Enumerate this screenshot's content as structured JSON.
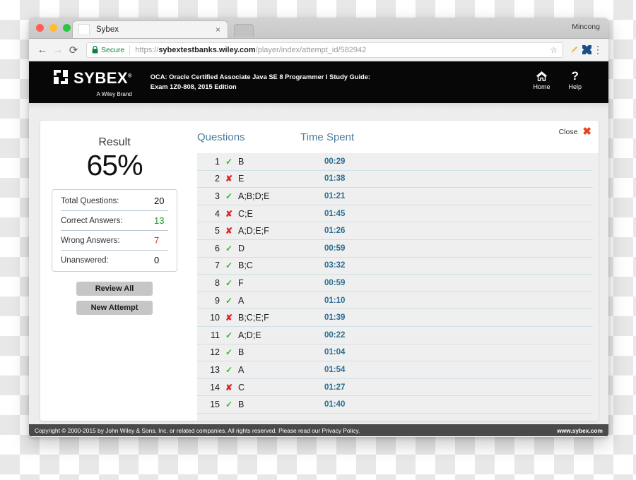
{
  "browser": {
    "tab_title": "Sybex",
    "tab_close": "×",
    "profile_name": "Mincong",
    "back_icon": "←",
    "forward_icon": "→",
    "reload_icon": "⟳",
    "secure_label": "Secure",
    "url_scheme": "https://",
    "url_domain": "sybextestbanks.wiley.com",
    "url_path": "/player/index/attempt_id/582942",
    "star_icon": "☆",
    "menu_icon": "⋮"
  },
  "site_header": {
    "logo_word": "SYBEX",
    "logo_reg": "®",
    "logo_sub": "A Wiley Brand",
    "book_title_line1": "OCA: Oracle Certified Associate Java SE 8 Programmer I Study Guide:",
    "book_title_line2": "Exam 1Z0-808, 2015 Edition",
    "actions": [
      {
        "label": "Home",
        "icon": "home-icon"
      },
      {
        "label": "Help",
        "icon": "question-mark-icon",
        "glyph": "?"
      }
    ]
  },
  "result_panel": {
    "title": "Result",
    "percent": "65%",
    "stats": [
      {
        "label": "Total Questions:",
        "value": "20",
        "color": "default"
      },
      {
        "label": "Correct Answers:",
        "value": "13",
        "color": "green"
      },
      {
        "label": "Wrong Answers:",
        "value": "7",
        "color": "red"
      },
      {
        "label": "Unanswered:",
        "value": "0",
        "color": "default"
      }
    ],
    "buttons": [
      {
        "label": "Review All"
      },
      {
        "label": "New Attempt"
      }
    ]
  },
  "questions_panel": {
    "col_questions": "Questions",
    "col_time": "Time Spent",
    "close_label": "Close",
    "close_icon": "✖",
    "rows": [
      {
        "num": "1",
        "correct": true,
        "answer": "B",
        "time": "00:29"
      },
      {
        "num": "2",
        "correct": false,
        "answer": "E",
        "time": "01:38"
      },
      {
        "num": "3",
        "correct": true,
        "answer": "A;B;D;E",
        "time": "01:21"
      },
      {
        "num": "4",
        "correct": false,
        "answer": "C;E",
        "time": "01:45"
      },
      {
        "num": "5",
        "correct": false,
        "answer": "A;D;E;F",
        "time": "01:26"
      },
      {
        "num": "6",
        "correct": true,
        "answer": "D",
        "time": "00:59"
      },
      {
        "num": "7",
        "correct": true,
        "answer": "B;C",
        "time": "03:32"
      },
      {
        "num": "8",
        "correct": true,
        "answer": "F",
        "time": "00:59"
      },
      {
        "num": "9",
        "correct": true,
        "answer": "A",
        "time": "01:10"
      },
      {
        "num": "10",
        "correct": false,
        "answer": "B;C;E;F",
        "time": "01:39"
      },
      {
        "num": "11",
        "correct": true,
        "answer": "A;D;E",
        "time": "00:22"
      },
      {
        "num": "12",
        "correct": true,
        "answer": "B",
        "time": "01:04"
      },
      {
        "num": "13",
        "correct": true,
        "answer": "A",
        "time": "01:54"
      },
      {
        "num": "14",
        "correct": false,
        "answer": "C",
        "time": "01:27"
      },
      {
        "num": "15",
        "correct": true,
        "answer": "B",
        "time": "01:40"
      }
    ],
    "mark_correct": "✓",
    "mark_wrong": "✘"
  },
  "footer": {
    "copyright": "Copyright © 2000-2015 by John Wiley & Sons, Inc. or related companies. All rights reserved. Please read our Privacy Policy.",
    "site": "www.sybex.com"
  },
  "colors": {
    "accent_blue": "#4c7e9e",
    "time_blue": "#2b6e91",
    "correct_green": "#2cbb2c",
    "wrong_red": "#e02020",
    "close_orange": "#e8441c",
    "secure_green": "#0b8043"
  }
}
